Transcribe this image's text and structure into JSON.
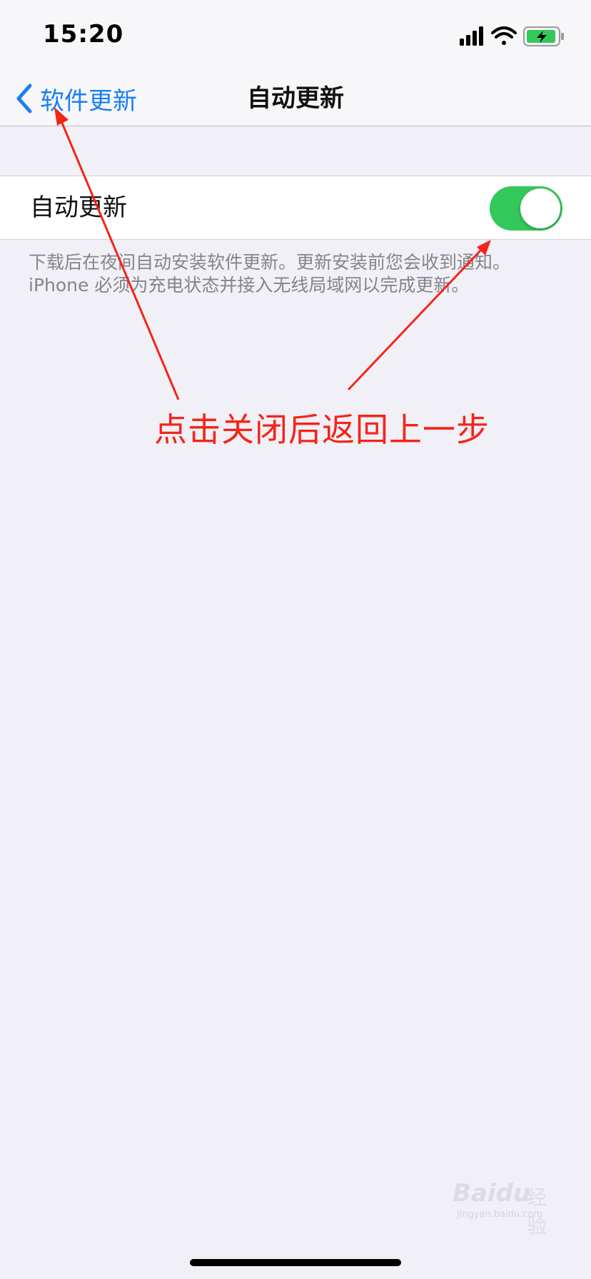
{
  "status_bar": {
    "time": "15:20",
    "icons": [
      "signal-icon",
      "wifi-icon",
      "battery-charging-icon"
    ],
    "battery_color": "#34c759"
  },
  "nav": {
    "back_label": "软件更新",
    "title": "自动更新",
    "accent_color": "#1a7ef5"
  },
  "setting": {
    "label": "自动更新",
    "toggle_on": true,
    "toggle_color": "#34c759"
  },
  "footer_note": {
    "line1": "下载后在夜间自动安装软件更新。更新安装前您会收到通知。",
    "line2": "iPhone 必须为充电状态并接入无线局域网以完成更新。"
  },
  "annotation": {
    "text": "点击关闭后返回上一步",
    "color": "#f52418"
  },
  "watermark": {
    "brand": "Baidu",
    "cn": "经验",
    "url": "jingyan.baidu.com"
  }
}
